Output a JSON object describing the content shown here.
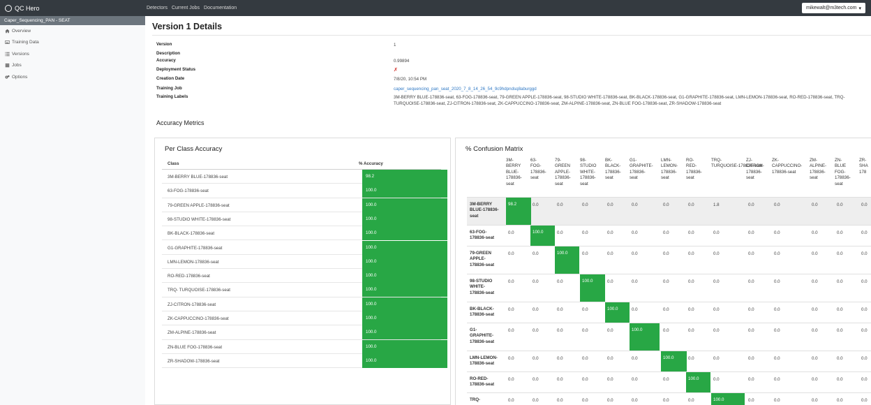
{
  "app": {
    "name": "QC Hero",
    "brand_color": "#343a40",
    "accent_color": "#28a745"
  },
  "nav": {
    "links": [
      "Detectors",
      "Current Jobs",
      "Documentation"
    ],
    "user": "mikewalt@m3tech.com"
  },
  "sidebar": {
    "project": "Caper_Sequencing_PAN - SEAT",
    "items": [
      {
        "label": "Overview",
        "icon": "home-icon"
      },
      {
        "label": "Training Data",
        "icon": "image-icon"
      },
      {
        "label": "Versions",
        "icon": "list-icon"
      },
      {
        "label": "Jobs",
        "icon": "database-icon"
      },
      {
        "label": "Options",
        "icon": "gears-icon"
      }
    ]
  },
  "page": {
    "title": "Version 1 Details"
  },
  "details": {
    "version_label": "Version",
    "version": "1",
    "description_label": "Description",
    "accuracy_label": "Accuracy",
    "accuracy": "0.99894",
    "deployment_label": "Deployment Status",
    "deployment_icon": "x-mark-icon",
    "creation_label": "Creation Date",
    "creation": "7/8/20, 10:54 PM",
    "job_label": "Training Job",
    "job": "caper_sequencing_pan_seat_2020_7_8_14_26_54_9c9hdpndsq8aburggd",
    "labels_label": "Training Labels",
    "labels": "3M-BERRY BLUE-178836-seat, 63-FOG-178836-seat, 79-GREEN APPLE-178836-seat, 98-STUDIO WHITE-178836-seat, BK-BLACK-178836-seat, G1-GRAPHITE-178836-seat, LMN-LEMON-178836-seat, RO-RED-178836-seat, TRQ-TURQUOISE-178836-seat, ZJ-CITRON-178836-seat, ZK-CAPPUCCINO-178836-seat, ZM-ALPINE-178836-seat, ZN-BLUE FOG-178836-seat, ZR-SHADOW-178836-seat"
  },
  "metrics": {
    "title": "Accuracy Metrics"
  },
  "per_class": {
    "title": "Per Class Accuracy",
    "col_class": "Class",
    "col_accuracy": "% Accuracy",
    "rows": [
      {
        "cls": "3M-BERRY BLUE-178836-seat",
        "acc": "98.2"
      },
      {
        "cls": "63-FOG-178836-seat",
        "acc": "100.0"
      },
      {
        "cls": "79-GREEN APPLE-178836-seat",
        "acc": "100.0"
      },
      {
        "cls": "98-STUDIO WHITE-178836-seat",
        "acc": "100.0"
      },
      {
        "cls": "BK-BLACK-178836-seat",
        "acc": "100.0"
      },
      {
        "cls": "G1-GRAPHITE-178836-seat",
        "acc": "100.0"
      },
      {
        "cls": "LMN-LEMON-178836-seat",
        "acc": "100.0"
      },
      {
        "cls": "RO-RED-178836-seat",
        "acc": "100.0"
      },
      {
        "cls": "TRQ- TURQUOISE-178836-seat",
        "acc": "100.0"
      },
      {
        "cls": "ZJ-CITRON-178836-seat",
        "acc": "100.0"
      },
      {
        "cls": "ZK-CAPPUCCINO-178836-seat",
        "acc": "100.0"
      },
      {
        "cls": "ZM-ALPINE-178836-seat",
        "acc": "100.0"
      },
      {
        "cls": "ZN-BLUE FOG-178836-seat",
        "acc": "100.0"
      },
      {
        "cls": "ZR-SHADOW-178836-seat",
        "acc": "100.0"
      }
    ]
  },
  "confusion": {
    "title": "% Confusion Matrix",
    "columns": [
      [
        "3M-",
        "BERRY",
        "BLUE-",
        "178836-",
        "seat"
      ],
      [
        "63-",
        "FOG-",
        "178836-",
        "seat"
      ],
      [
        "79-",
        "GREEN",
        "APPLE-",
        "178836-",
        "seat"
      ],
      [
        "98-",
        "STUDIO",
        "WHITE-",
        "178836-",
        "seat"
      ],
      [
        "BK-",
        "BLACK-",
        "178836-",
        "seat"
      ],
      [
        "G1-",
        "GRAPHITE-",
        "178836-",
        "seat"
      ],
      [
        "LMN-",
        "LEMON-",
        "178836-",
        "seat"
      ],
      [
        "RO-",
        "RED-",
        "178836-",
        "seat"
      ],
      [
        "TRQ-",
        "TURQUOISE-178836-seat"
      ],
      [
        "ZJ-",
        "CITRON-",
        "178836-",
        "seat"
      ],
      [
        "ZK-",
        "CAPPUCCINO-",
        "178836-seat"
      ],
      [
        "ZM-",
        "ALPINE-",
        "178836-",
        "seat"
      ],
      [
        "ZN-",
        "BLUE",
        "FOG-",
        "178836-",
        "seat"
      ],
      [
        "ZR-",
        "SHA",
        "178"
      ]
    ],
    "rows": [
      {
        "label": [
          "3M-BERRY",
          "BLUE-178836-",
          "seat"
        ],
        "values": [
          "98.2",
          "0.0",
          "0.0",
          "0.0",
          "0.0",
          "0.0",
          "0.0",
          "0.0",
          "1.8",
          "0.0",
          "0.0",
          "0.0",
          "0.0",
          "0.0"
        ]
      },
      {
        "label": [
          "63-FOG-",
          "178836-seat"
        ],
        "values": [
          "0.0",
          "100.0",
          "0.0",
          "0.0",
          "0.0",
          "0.0",
          "0.0",
          "0.0",
          "0.0",
          "0.0",
          "0.0",
          "0.0",
          "0.0",
          "0.0"
        ]
      },
      {
        "label": [
          "79-GREEN",
          "APPLE-",
          "178836-seat"
        ],
        "values": [
          "0.0",
          "0.0",
          "100.0",
          "0.0",
          "0.0",
          "0.0",
          "0.0",
          "0.0",
          "0.0",
          "0.0",
          "0.0",
          "0.0",
          "0.0",
          "0.0"
        ]
      },
      {
        "label": [
          "98-STUDIO",
          "WHITE-",
          "178836-seat"
        ],
        "values": [
          "0.0",
          "0.0",
          "0.0",
          "100.0",
          "0.0",
          "0.0",
          "0.0",
          "0.0",
          "0.0",
          "0.0",
          "0.0",
          "0.0",
          "0.0",
          "0.0"
        ]
      },
      {
        "label": [
          "BK-BLACK-",
          "178836-seat"
        ],
        "values": [
          "0.0",
          "0.0",
          "0.0",
          "0.0",
          "100.0",
          "0.0",
          "0.0",
          "0.0",
          "0.0",
          "0.0",
          "0.0",
          "0.0",
          "0.0",
          "0.0"
        ]
      },
      {
        "label": [
          "G1-",
          "GRAPHITE-",
          "178836-seat"
        ],
        "values": [
          "0.0",
          "0.0",
          "0.0",
          "0.0",
          "0.0",
          "100.0",
          "0.0",
          "0.0",
          "0.0",
          "0.0",
          "0.0",
          "0.0",
          "0.0",
          "0.0"
        ]
      },
      {
        "label": [
          "LMN-LEMON-",
          "178836-seat"
        ],
        "values": [
          "0.0",
          "0.0",
          "0.0",
          "0.0",
          "0.0",
          "0.0",
          "100.0",
          "0.0",
          "0.0",
          "0.0",
          "0.0",
          "0.0",
          "0.0",
          "0.0"
        ]
      },
      {
        "label": [
          "RO-RED-",
          "178836-seat"
        ],
        "values": [
          "0.0",
          "0.0",
          "0.0",
          "0.0",
          "0.0",
          "0.0",
          "0.0",
          "100.0",
          "0.0",
          "0.0",
          "0.0",
          "0.0",
          "0.0",
          "0.0"
        ]
      },
      {
        "label": [
          "TRQ-"
        ],
        "values": [
          "0.0",
          "0.0",
          "0.0",
          "0.0",
          "0.0",
          "0.0",
          "0.0",
          "0.0",
          "100.0",
          "0.0",
          "0.0",
          "0.0",
          "0.0",
          "0.0"
        ]
      }
    ]
  }
}
